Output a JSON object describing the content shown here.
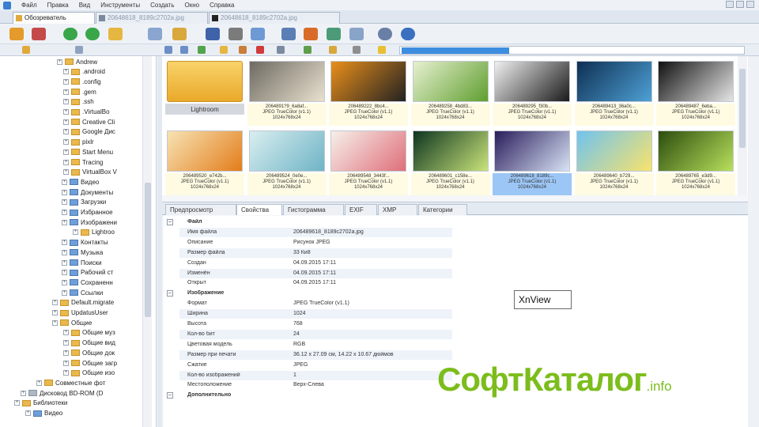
{
  "menu": [
    "Файл",
    "Правка",
    "Вид",
    "Инструменты",
    "Создать",
    "Окно",
    "Справка"
  ],
  "doc_tabs": [
    "Обозреватель",
    "20648618_8189c2702a.jpg",
    "20648618_8189c2702a.jpg"
  ],
  "tree": {
    "items": [
      {
        "label": "Andrew",
        "type": "folder"
      },
      {
        "label": ".android",
        "type": "folder"
      },
      {
        "label": ".config",
        "type": "folder"
      },
      {
        "label": ".gem",
        "type": "folder"
      },
      {
        "label": ".ssh",
        "type": "folder"
      },
      {
        "label": ".VirtualBo",
        "type": "folder"
      },
      {
        "label": "Creative Cli",
        "type": "folder"
      },
      {
        "label": "Google Дис",
        "type": "folder"
      },
      {
        "label": "pixlr",
        "type": "folder"
      },
      {
        "label": "Start Menu",
        "type": "folder"
      },
      {
        "label": "Tracing",
        "type": "folder"
      },
      {
        "label": "VirtualBox V",
        "type": "folder"
      },
      {
        "label": "Видео",
        "type": "folder"
      },
      {
        "label": "Документы",
        "type": "folder"
      },
      {
        "label": "Загрузки",
        "type": "folder"
      },
      {
        "label": "Избранное",
        "type": "folder"
      },
      {
        "label": "Изображени",
        "type": "folder"
      },
      {
        "label": "Lightroo",
        "type": "folder"
      },
      {
        "label": "Контакты",
        "type": "folder"
      },
      {
        "label": "Музыка",
        "type": "folder"
      },
      {
        "label": "Поиски",
        "type": "folder"
      },
      {
        "label": "Рабочий ст",
        "type": "folder"
      },
      {
        "label": "Сохраненн",
        "type": "folder"
      },
      {
        "label": "Ссылки",
        "type": "folder"
      },
      {
        "label": "Default.migrate",
        "type": "folder"
      },
      {
        "label": "UpdatusUser",
        "type": "folder"
      },
      {
        "label": "Общие",
        "type": "folder"
      },
      {
        "label": "Общие муз",
        "type": "folder"
      },
      {
        "label": "Общие вид",
        "type": "folder"
      },
      {
        "label": "Общие док",
        "type": "folder"
      },
      {
        "label": "Общие загр",
        "type": "folder"
      },
      {
        "label": "Общие изо",
        "type": "folder"
      },
      {
        "label": "Совместные фот",
        "type": "folder"
      },
      {
        "label": "Дисковод BD-ROM (D",
        "type": "drive"
      },
      {
        "label": "Библиотеки",
        "type": "folder"
      },
      {
        "label": "Видео",
        "type": "folder"
      }
    ]
  },
  "thumbnails": [
    {
      "label": "Lightroom",
      "lines": [],
      "kind": "folder"
    },
    {
      "label": "2064891?9_6a8af...",
      "lines": [
        "JPEG TrueColor (v1.1)",
        "1024x768x24"
      ]
    },
    {
      "label": "206489222_8bc4...",
      "lines": [
        "JPEG TrueColor (v1.1)",
        "1024x768x24"
      ]
    },
    {
      "label": "206489258_4bd83...",
      "lines": [
        "JPEG TrueColor (v1.1)",
        "1024x768x24"
      ]
    },
    {
      "label": "206489295_f30b...",
      "lines": [
        "JPEG TrueColor (v1.1)",
        "1024x768x24"
      ]
    },
    {
      "label": "206489413_36a0c...",
      "lines": [
        "JPEG TrueColor (v1.1)",
        "1024x768x24"
      ]
    },
    {
      "label": "206489487_6eba...",
      "lines": [
        "JPEG TrueColor (v1.1)",
        "1024x768x24"
      ]
    },
    {
      "label": "206489520_e742b...",
      "lines": [
        "JPEG TrueColor (v1.1)",
        "1024x768x24"
      ]
    },
    {
      "label": "206489524_0e0e...",
      "lines": [
        "JPEG TrueColor (v1.1)",
        "1024x768x24"
      ]
    },
    {
      "label": "206489548_3443f...",
      "lines": [
        "JPEG TrueColor (v1.1)",
        "1024x768x24"
      ]
    },
    {
      "label": "206489601_c158e...",
      "lines": [
        "JPEG TrueColor (v1.1)",
        "1024x768x24"
      ]
    },
    {
      "label": "206489618_8189c...",
      "lines": [
        "JPEG TrueColor (v1.1)",
        "1024x768x24"
      ],
      "selected": true
    },
    {
      "label": "206489640_b729...",
      "lines": [
        "JPEG TrueColor (v1.1)",
        "1024x768x24"
      ]
    },
    {
      "label": "206489765_e3d9...",
      "lines": [
        "JPEG TrueColor (v1.1)",
        "1024x768x24"
      ]
    }
  ],
  "thumb_colors": [
    [
      "#f4c34a",
      "#e8a21d"
    ],
    [
      "#6e6a62",
      "#e9e1cf"
    ],
    [
      "#e98f1a",
      "#222"
    ],
    [
      "#e7f0d0",
      "#5f9f2f"
    ],
    [
      "#f1f0f0",
      "#1a1a1a"
    ],
    [
      "#0e2f52",
      "#4ea1d6"
    ],
    [
      "#111",
      "#e6e6e6"
    ],
    [
      "#f7e3b4",
      "#e37d1b"
    ],
    [
      "#d9eef0",
      "#6fb4c6"
    ],
    [
      "#f6f0ea",
      "#df6f7a"
    ],
    [
      "#0e3520",
      "#c9e47a"
    ],
    [
      "#2a1d5c",
      "#d7e3f5"
    ],
    [
      "#6fc3ef",
      "#f8e36c"
    ],
    [
      "#2c4d0e",
      "#b8e05c"
    ]
  ],
  "prop_tabs": [
    "Предпросмотр",
    "Свойства",
    "Гистограмма",
    "EXIF",
    "XMP",
    "Категории"
  ],
  "properties": [
    {
      "name": "Файл",
      "value": "",
      "group": true
    },
    {
      "name": "Имя файла",
      "value": "206489618_8189c2702a.jpg"
    },
    {
      "name": "Описание",
      "value": "Рисунок JPEG"
    },
    {
      "name": "Размер файла",
      "value": "33 Ки8"
    },
    {
      "name": "Создан",
      "value": "04.09.2015 17:11"
    },
    {
      "name": "Изменён",
      "value": "04.09.2015 17:11"
    },
    {
      "name": "Открыт",
      "value": "04.09.2015 17:11"
    },
    {
      "name": "Изображение",
      "value": "",
      "group": true
    },
    {
      "name": "Формат",
      "value": "JPEG TrueColor (v1.1)"
    },
    {
      "name": "Ширина",
      "value": "1024"
    },
    {
      "name": "Высота",
      "value": "768"
    },
    {
      "name": "Кол-во бит",
      "value": "24"
    },
    {
      "name": "Цветовая модель",
      "value": "RGB"
    },
    {
      "name": "Размер при печати",
      "value": "36.12 x 27.09 см, 14.22 x 10.67 дюймов"
    },
    {
      "name": "Сжатие",
      "value": "JPEG"
    },
    {
      "name": "Кол-во изображений",
      "value": "1"
    },
    {
      "name": "Местоположение",
      "value": "Верх-Слева"
    },
    {
      "name": "Дополнительно",
      "value": "",
      "group": true
    }
  ],
  "callout": "XnView",
  "logo": {
    "main": "СофтКаталог",
    "suffix": ".info",
    "color": "#7cbd1c"
  }
}
